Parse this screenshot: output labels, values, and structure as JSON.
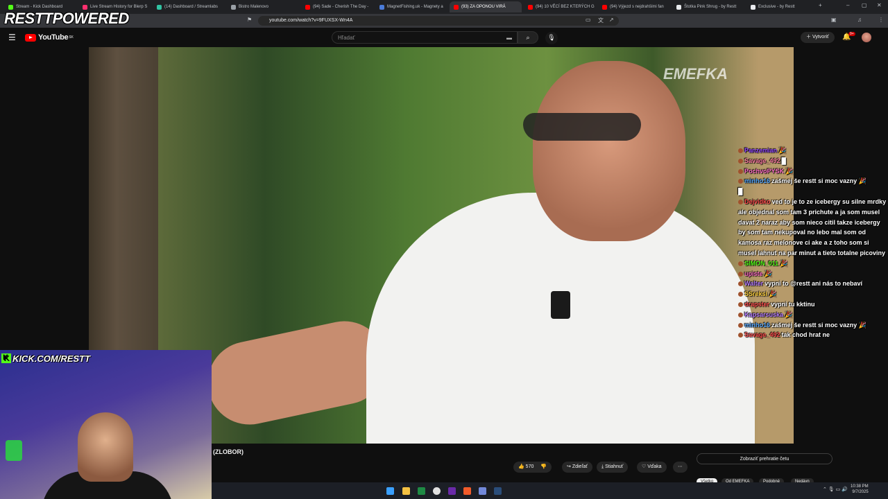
{
  "browser": {
    "tabs": [
      {
        "label": "Stream - Kick Dashboard",
        "color": "#53fc18"
      },
      {
        "label": "Live Stream History for Blerp S",
        "color": "#ff2f6e"
      },
      {
        "label": "(14) Dashboard / Streamlabs",
        "color": "#31c3a2"
      },
      {
        "label": "Bistro Malenovo",
        "color": "#9aa0a6"
      },
      {
        "label": "(94) Sade - Cherish The Day -",
        "color": "#ff0000"
      },
      {
        "label": "MagnetFishing.uk - Magnety a",
        "color": "#4a7bd8"
      },
      {
        "label": "(93) ZA OPONOU VIRÁ",
        "color": "#ff0000",
        "active": true
      },
      {
        "label": "(94) 10 VĚCÍ BEZ KTERÝCH G",
        "color": "#ff0000"
      },
      {
        "label": "(94) Výjezd s nejdrahšími fan",
        "color": "#ff0000"
      },
      {
        "label": "Štotka Pink Shrug - by Restt",
        "color": "#e8eaed"
      },
      {
        "label": "Exclusive - by Restt",
        "color": "#e8eaed"
      }
    ],
    "url": "youtube.com/watch?v=9FUXSX-Wn4A"
  },
  "overlay": {
    "brand": "RESTTPOWERED",
    "kick": "KICK.COM/RESTT",
    "watermark": "EMEFKA"
  },
  "youtube": {
    "logo": "YouTube",
    "region": "SK",
    "search_placeholder": "Hľadať",
    "create_label": "Vytvoriť",
    "notif_badge": "9+",
    "video_title": "(ZLOBOR)",
    "like_count": "570",
    "share_label": "Zdieľať",
    "download_label": "Stiahnuť",
    "thanks_label": "Vďaka",
    "chat_replay_label": "Zobraziť prehratie četu",
    "chips": [
      "Všetko",
      "Od EMEFKA",
      "Podobné",
      "Nedávn"
    ]
  },
  "chat": [
    {
      "user": "Panzemian",
      "color": "#9147ff",
      "text": "🎉"
    },
    {
      "user": "Savage_492",
      "color": "#ff7fa3",
      "text": "█"
    },
    {
      "user": "PochvoPYSK",
      "color": "#ff6ec7",
      "text": "🎉"
    },
    {
      "user": "minho16",
      "color": "#56a8ff",
      "text": "zašmej še restt si moc vazny 🎉"
    },
    {
      "user": "",
      "color": "#ffffff",
      "text": "█"
    },
    {
      "user": "Dejvidko",
      "color": "#ff4d4d",
      "text": "ved to je to ze icebergy su silne mrdky ale objednal som tam 3 prichute a ja som musel davat 2 naraz aby som nieco citil takze icebergy by som tam nekupoval no lebo mal som od kamosa raz melonove ci ake a z toho som si musel lahnut na par minut a tieto totalne picoviny"
    },
    {
      "user": "SIMON_011",
      "color": "#53fc18",
      "text": "🎉"
    },
    {
      "user": "upiste",
      "color": "#ff6ec7",
      "text": "🎉"
    },
    {
      "user": "Walter",
      "color": "#b57cff",
      "text": "vypni to @restt ani nás to nebaví"
    },
    {
      "user": "SSreksi",
      "color": "#ffd23f",
      "text": "🎉"
    },
    {
      "user": "drapster",
      "color": "#ff4d4d",
      "text": "vypni tu kktinu"
    },
    {
      "user": "Kapsarsuska",
      "color": "#b57cff",
      "text": "🎉"
    },
    {
      "user": "minho16",
      "color": "#56a8ff",
      "text": "zašmej še restt si moc vazny 🎉"
    },
    {
      "user": "Savage_492",
      "color": "#ff4d4d",
      "text": "tak chod hrat ne"
    }
  ],
  "system": {
    "time": "10:38 PM",
    "date": "9/7/2025"
  }
}
